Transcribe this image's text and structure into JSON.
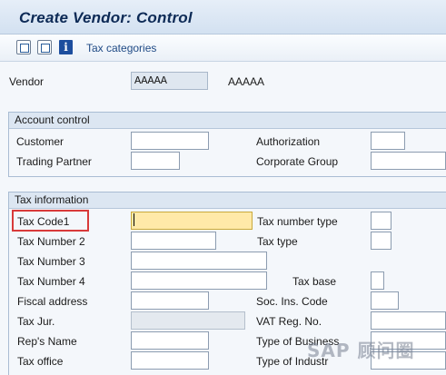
{
  "title": "Create Vendor: Control",
  "toolbar": {
    "icons": [
      "detail-icon",
      "tree-icon",
      "info-icon"
    ],
    "info_glyph": "i",
    "tax_categories": "Tax categories"
  },
  "vendor": {
    "label": "Vendor",
    "value": "AAAAA",
    "name": "AAAAA"
  },
  "account_control": {
    "title": "Account control",
    "customer": "Customer",
    "authorization": "Authorization",
    "trading_partner": "Trading Partner",
    "corporate_group": "Corporate Group"
  },
  "tax_info": {
    "title": "Tax information",
    "tax_code1": "Tax Code1",
    "tax_number_type": "Tax number type",
    "tax_number2": "Tax Number 2",
    "tax_type": "Tax type",
    "tax_number3": "Tax Number 3",
    "tax_number4": "Tax Number 4",
    "tax_base": "Tax base",
    "fiscal_address": "Fiscal address",
    "soc_ins_code": "Soc. Ins. Code",
    "tax_jur": "Tax Jur.",
    "vat_reg_no": "VAT Reg. No.",
    "reps_name": "Rep's Name",
    "type_of_business": "Type of Business",
    "tax_office": "Tax office",
    "type_of_industry": "Type of Industr"
  },
  "watermark": "SAP 顾问圈",
  "colors": {
    "highlight": "#d83a3a",
    "focus_field": "#ffe9a8",
    "title": "#0d2a56"
  }
}
